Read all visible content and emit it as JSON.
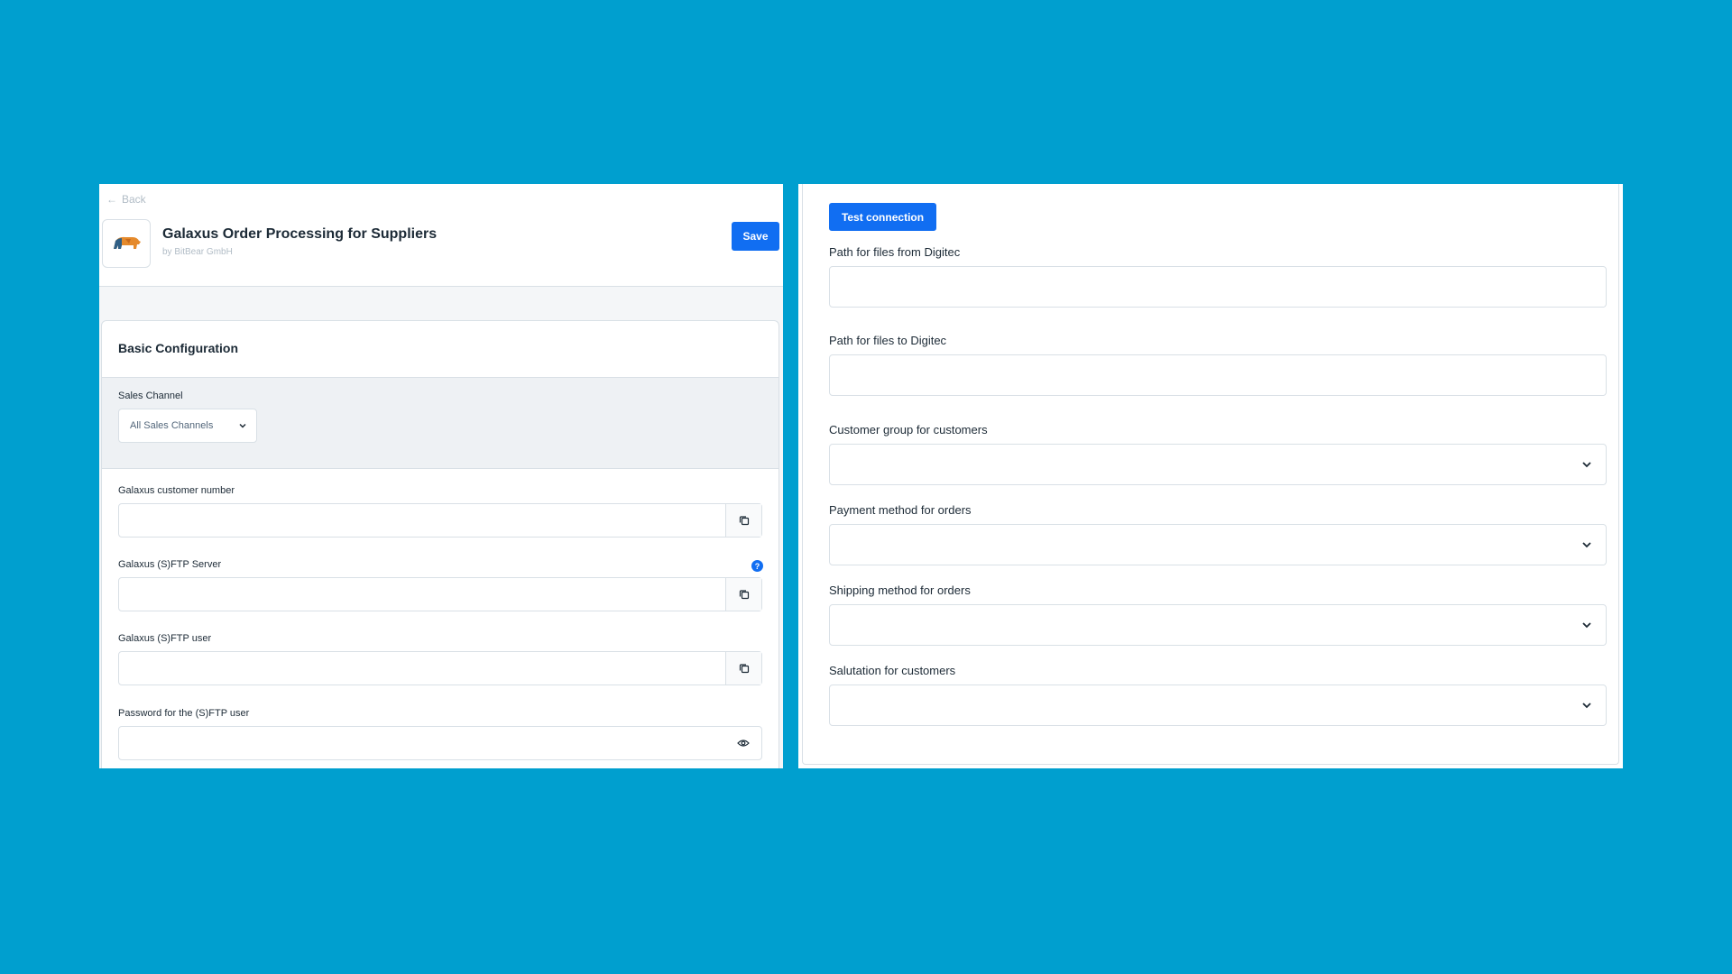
{
  "header": {
    "back_label": "Back",
    "app_title": "Galaxus Order Processing for Suppliers",
    "vendor": "by BitBear GmbH",
    "save_label": "Save"
  },
  "basic_config": {
    "title": "Basic Configuration",
    "sales_channel_label": "Sales Channel",
    "sales_channel_value": "All Sales Channels"
  },
  "fields": {
    "customer_number": {
      "label": "Galaxus customer number",
      "value": ""
    },
    "sftp_server": {
      "label": "Galaxus (S)FTP Server",
      "value": ""
    },
    "sftp_user": {
      "label": "Galaxus (S)FTP user",
      "value": ""
    },
    "sftp_password": {
      "label": "Password for the (S)FTP user",
      "value": ""
    }
  },
  "right": {
    "test_connection_label": "Test connection",
    "path_from": {
      "label": "Path for files from Digitec",
      "value": ""
    },
    "path_to": {
      "label": "Path for files to Digitec",
      "value": ""
    },
    "customer_group": {
      "label": "Customer group for customers",
      "value": ""
    },
    "payment_method": {
      "label": "Payment method for orders",
      "value": ""
    },
    "shipping_method": {
      "label": "Shipping method for orders",
      "value": ""
    },
    "salutation": {
      "label": "Salutation for customers",
      "value": ""
    }
  },
  "colors": {
    "background": "#009fcf",
    "primary_button": "#116ef2",
    "text": "#1c2a36",
    "muted_text": "#b1bcc6",
    "border": "#d9e0e6"
  },
  "icons": {
    "back": "arrow-left-icon",
    "logo": "bear-logo-icon",
    "copy": "copy-icon",
    "help": "help-circle-icon",
    "reveal": "eye-icon",
    "dropdown": "chevron-down-icon"
  }
}
